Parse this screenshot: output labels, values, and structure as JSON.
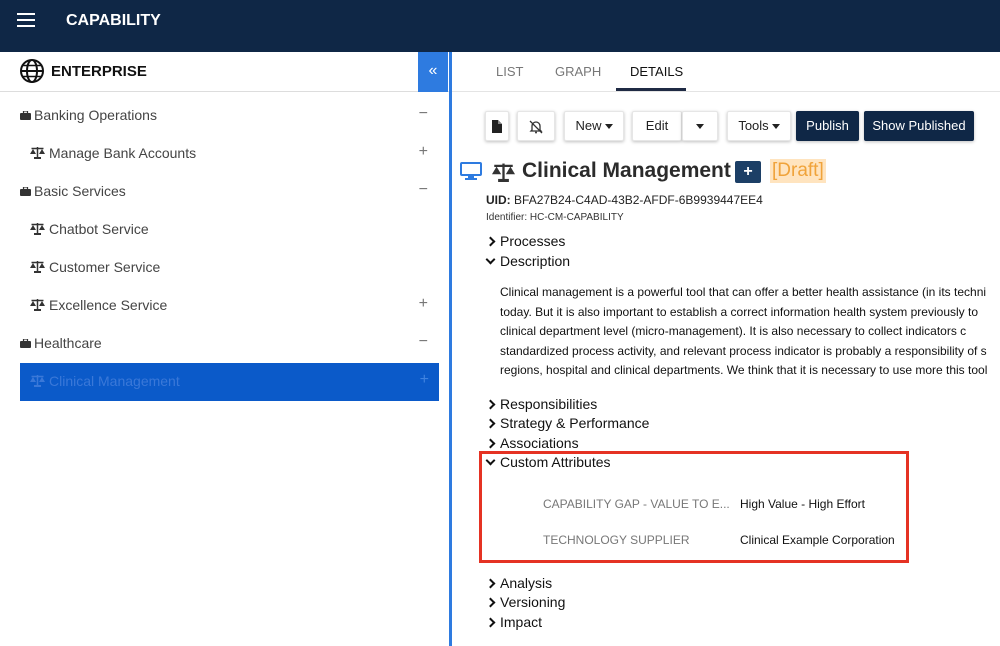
{
  "app": {
    "title": "CAPABILITY",
    "menu_icon": "hamburger-menu-icon"
  },
  "sidebar": {
    "title": "ENTERPRISE",
    "collapse_label": "«",
    "items": [
      {
        "label": "Banking Operations",
        "toggle": "−",
        "level": 0,
        "icon": "briefcase-icon"
      },
      {
        "label": "Manage Bank Accounts",
        "toggle": "+",
        "level": 1,
        "icon": "scale-icon"
      },
      {
        "label": "Basic Services",
        "toggle": "−",
        "level": 0,
        "icon": "briefcase-icon"
      },
      {
        "label": "Chatbot Service",
        "toggle": "",
        "level": 1,
        "icon": "scale-icon"
      },
      {
        "label": "Customer Service",
        "toggle": "",
        "level": 1,
        "icon": "scale-icon"
      },
      {
        "label": "Excellence Service",
        "toggle": "+",
        "level": 1,
        "icon": "scale-icon"
      },
      {
        "label": "Healthcare",
        "toggle": "−",
        "level": 0,
        "icon": "briefcase-icon"
      },
      {
        "label": "Clinical Management",
        "toggle": "+",
        "level": 1,
        "icon": "scale-icon",
        "selected": true
      }
    ]
  },
  "tabs": [
    {
      "label": "LIST"
    },
    {
      "label": "GRAPH"
    },
    {
      "label": "DETAILS",
      "active": true
    }
  ],
  "toolbar": {
    "new_label": "New",
    "edit_label": "Edit",
    "tools_label": "Tools",
    "publish_label": "Publish",
    "show_published_label": "Show Published"
  },
  "details": {
    "title": "Clinical Management",
    "add_label": "+",
    "status": "[Draft]",
    "uid_label": "UID:",
    "uid_value": "BFA27B24-C4AD-43B2-AFDF-6B9939447EE4",
    "identifier": "Identifier:  HC-CM-CAPABILITY",
    "sections": {
      "processes": "Processes",
      "description": "Description",
      "responsibilities": "Responsibilities",
      "strategy": "Strategy & Performance",
      "associations": "Associations",
      "custom_attributes": "Custom Attributes",
      "analysis": "Analysis",
      "versioning": "Versioning",
      "impact": "Impact"
    },
    "description_lines": [
      "Clinical management is a powerful tool that can offer a better health assistance (in its techni",
      "today.  But  it  is  also  important  to  establish  a  correct  information  health  system  previously  to",
      "clinical  department  level  (micro-management).  It  is  also  necessary  to  collect  indicators  c",
      "standardized process activity, and relevant process indicator is probably a responsibility of s",
      "regions, hospital and clinical departments. We think that it is necessary to use more this tool"
    ],
    "custom_attributes": [
      {
        "name": "CAPABILITY GAP - VALUE TO E...",
        "value": "High Value - High Effort"
      },
      {
        "name": "TECHNOLOGY SUPPLIER",
        "value": "Clinical Example Corporation"
      }
    ]
  },
  "colors": {
    "topbar": "#0f2746",
    "accent_blue": "#2e7be0",
    "selected_row": "#0b5ac9",
    "draft_bg": "#ffe4bf",
    "draft_text": "#f0a33a",
    "highlight_border": "#e53223"
  }
}
